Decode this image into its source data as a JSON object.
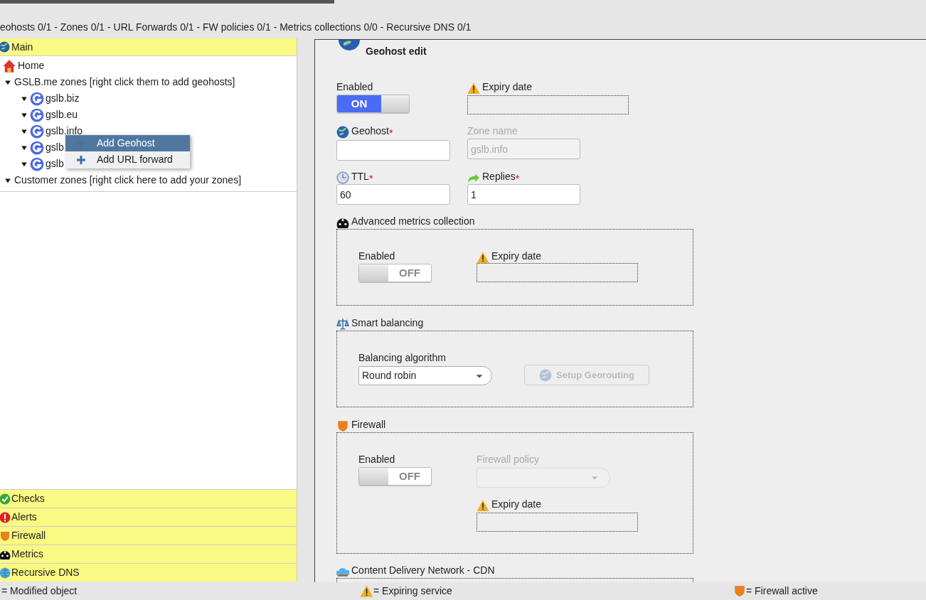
{
  "stats_line": "eohosts 0/1 - Zones 0/1 - URL Forwards 0/1 - FW policies 0/1 - Metrics collections 0/0 - Recursive DNS 0/1",
  "sidebar": {
    "main_section": "Main",
    "tree": [
      {
        "label": "Home",
        "kind": "home"
      },
      {
        "label": "GSLB.me zones [right click them to add geohosts]",
        "kind": "folder",
        "expanded": true,
        "children": [
          {
            "label": "gslb.biz",
            "kind": "zone",
            "expanded": true
          },
          {
            "label": "gslb.eu",
            "kind": "zone",
            "expanded": true
          },
          {
            "label": "gslb.info",
            "kind": "zone",
            "expanded": true
          },
          {
            "label": "gslb",
            "kind": "zone",
            "expanded": true
          },
          {
            "label": "gslb",
            "kind": "zone",
            "expanded": true
          }
        ]
      },
      {
        "label": "Customer zones [right click here to add your zones]",
        "kind": "folder",
        "expanded": true
      }
    ],
    "context_menu": [
      {
        "label": "Add Geohost",
        "selected": true
      },
      {
        "label": "Add URL forward",
        "selected": false
      }
    ],
    "sections": [
      "Checks",
      "Alerts",
      "Firewall",
      "Metrics",
      "Recursive DNS"
    ]
  },
  "form": {
    "title": "Geohost edit",
    "enabled": {
      "label": "Enabled",
      "on": true,
      "on_text": "ON"
    },
    "expiry": {
      "label": "Expiry date"
    },
    "geohost": {
      "label": "Geohost",
      "required_mark": "*"
    },
    "zone_name": {
      "label": "Zone name",
      "value": "gslb.info",
      "disabled": true
    },
    "ttl": {
      "label": "TTL",
      "required_mark": "*",
      "value": "60"
    },
    "replies": {
      "label": "Replies",
      "required_mark": "*",
      "value": "1"
    },
    "metrics": {
      "title": "Advanced metrics collection",
      "enabled_label": "Enabled",
      "on": false,
      "off_text": "OFF",
      "expiry_label": "Expiry date"
    },
    "balancing": {
      "title": "Smart balancing",
      "algorithm_label": "Balancing algorithm",
      "algorithm": "Round robin",
      "button": "Setup Georouting",
      "button_disabled": true
    },
    "firewall": {
      "title": "Firewall",
      "enabled_label": "Enabled",
      "on": false,
      "off_text": "OFF",
      "policy_label": "Firewall policy",
      "policy_disabled": true,
      "expiry_label": "Expiry date"
    },
    "cdn": {
      "title": "Content Delivery Network - CDN"
    }
  },
  "legend": [
    "= Modified object",
    "= Expiring service",
    "= Firewall active"
  ]
}
